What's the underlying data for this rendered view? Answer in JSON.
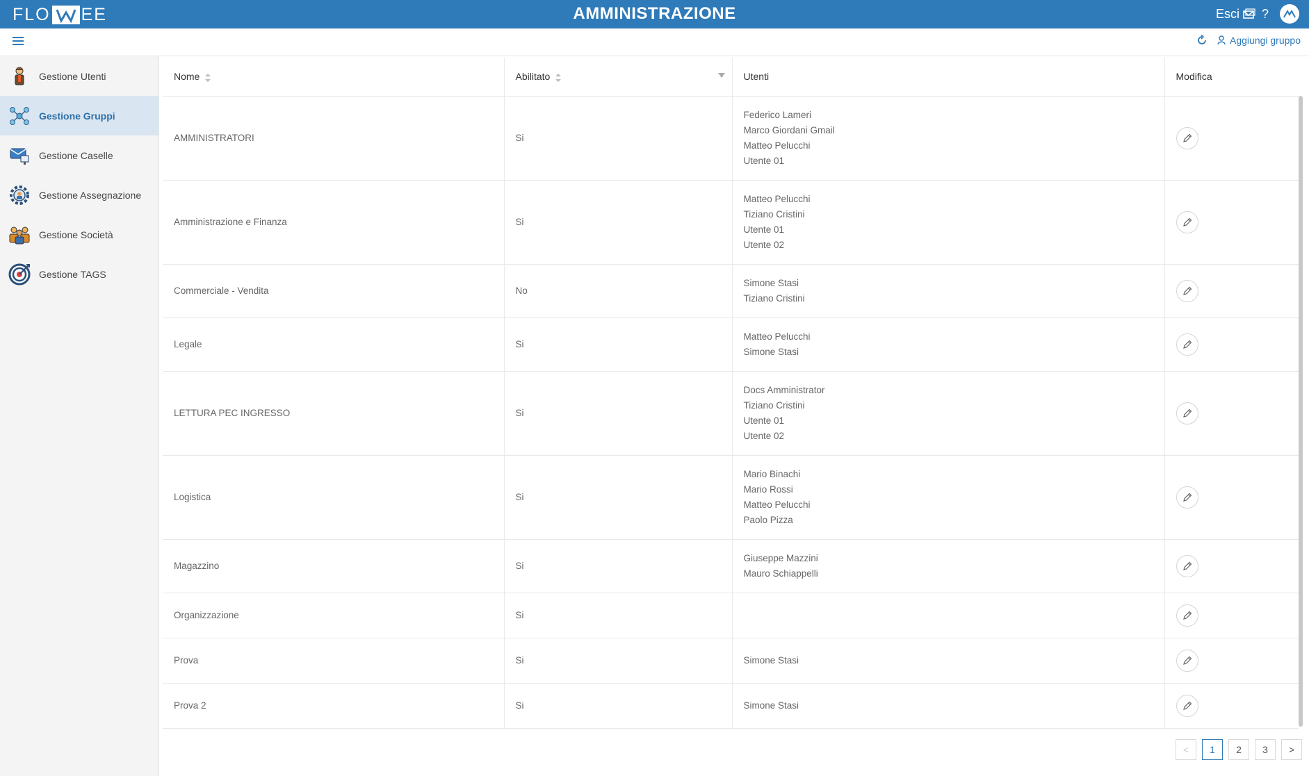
{
  "app": {
    "logo_left": "FLO",
    "logo_right": "EE",
    "title": "AMMINISTRAZIONE",
    "logout_label": "Esci",
    "help_label": "?",
    "brand_color": "#2f7ab8"
  },
  "toolbar": {
    "add_group_label": "Aggiungi gruppo"
  },
  "sidebar": {
    "items": [
      {
        "label": "Gestione Utenti",
        "icon": "user-icon",
        "active": false
      },
      {
        "label": "Gestione Gruppi",
        "icon": "group-network-icon",
        "active": true
      },
      {
        "label": "Gestione Caselle",
        "icon": "mailbox-icon",
        "active": false
      },
      {
        "label": "Gestione Assegnazione",
        "icon": "gear-people-icon",
        "active": false
      },
      {
        "label": "Gestione Società",
        "icon": "company-people-icon",
        "active": false
      },
      {
        "label": "Gestione TAGS",
        "icon": "target-icon",
        "active": false
      }
    ]
  },
  "table": {
    "columns": [
      "Nome",
      "Abilitato",
      "Utenti",
      "Modifica"
    ],
    "rows": [
      {
        "nome": "AMMINISTRATORI",
        "abilitato": "Si",
        "utenti": [
          "Federico Lameri",
          "Marco Giordani Gmail",
          "Matteo Pelucchi",
          "Utente 01"
        ]
      },
      {
        "nome": "Amministrazione e Finanza",
        "abilitato": "Si",
        "utenti": [
          "Matteo Pelucchi",
          "Tiziano Cristini",
          "Utente 01",
          "Utente 02"
        ]
      },
      {
        "nome": "Commerciale - Vendita",
        "abilitato": "No",
        "utenti": [
          "Simone Stasi",
          "Tiziano Cristini"
        ]
      },
      {
        "nome": "Legale",
        "abilitato": "Si",
        "utenti": [
          "Matteo Pelucchi",
          "Simone Stasi"
        ]
      },
      {
        "nome": "LETTURA PEC INGRESSO",
        "abilitato": "Si",
        "utenti": [
          "Docs Amministrator",
          "Tiziano Cristini",
          "Utente 01",
          "Utente 02"
        ]
      },
      {
        "nome": "Logistica",
        "abilitato": "Si",
        "utenti": [
          "Mario Binachi",
          "Mario Rossi",
          "Matteo Pelucchi",
          "Paolo Pizza"
        ]
      },
      {
        "nome": "Magazzino",
        "abilitato": "Si",
        "utenti": [
          "Giuseppe Mazzini",
          "Mauro Schiappelli"
        ]
      },
      {
        "nome": "Organizzazione",
        "abilitato": "Si",
        "utenti": []
      },
      {
        "nome": "Prova",
        "abilitato": "Si",
        "utenti": [
          "Simone Stasi"
        ]
      },
      {
        "nome": "Prova 2",
        "abilitato": "Si",
        "utenti": [
          "Simone Stasi"
        ]
      }
    ]
  },
  "pagination": {
    "pages": [
      "1",
      "2",
      "3"
    ],
    "current": "1",
    "prev_label": "<",
    "next_label": ">"
  }
}
